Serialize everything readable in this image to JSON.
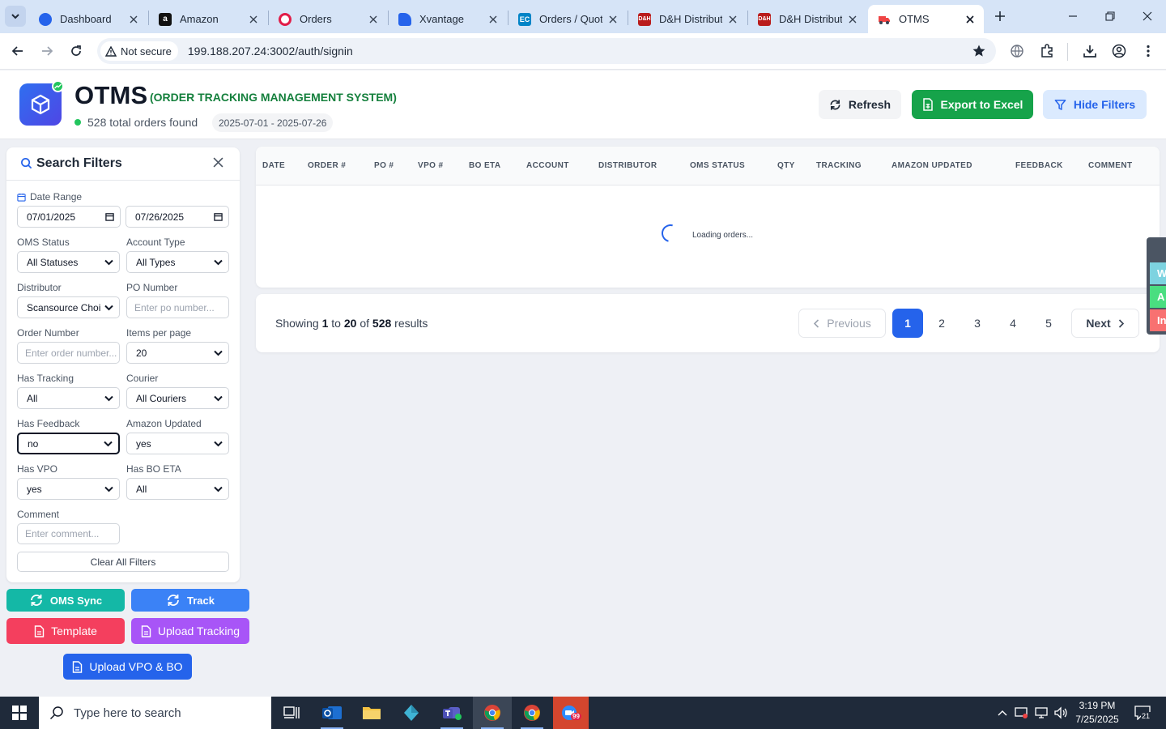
{
  "browser": {
    "tabs": [
      {
        "title": "Dashboard",
        "favicon": "globe-icon",
        "color": "#2563eb"
      },
      {
        "title": "Amazon",
        "favicon": "amazon-icon",
        "color": "#111111"
      },
      {
        "title": "Orders",
        "favicon": "orders-icon",
        "color": "#e11d48"
      },
      {
        "title": "Xvantage",
        "favicon": "xvantage-icon",
        "color": "#2563eb"
      },
      {
        "title": "Orders / Quot",
        "favicon": "ec-icon",
        "color": "#0284c7"
      },
      {
        "title": "D&H Distribut",
        "favicon": "dh-icon",
        "color": "#b91c1c"
      },
      {
        "title": "D&H Distribut",
        "favicon": "dh-icon",
        "color": "#b91c1c"
      },
      {
        "title": "OTMS",
        "favicon": "otms-icon",
        "color": "#ef4444",
        "active": true
      }
    ],
    "security_label": "Not secure",
    "url": "199.188.207.24:3002/auth/signin"
  },
  "header": {
    "title": "OTMS",
    "subtitle": "(ORDER TRACKING MANAGEMENT SYSTEM)",
    "orders_found": "528 total orders found",
    "date_range": "2025-07-01 - 2025-07-26",
    "refresh_label": "Refresh",
    "export_label": "Export to Excel",
    "hide_filters_label": "Hide Filters"
  },
  "filters": {
    "title": "Search Filters",
    "date_range_label": "Date Range",
    "date_from": "07/01/2025",
    "date_to": "07/26/2025",
    "oms_status": {
      "label": "OMS Status",
      "value": "All Statuses"
    },
    "account_type": {
      "label": "Account Type",
      "value": "All Types"
    },
    "distributor": {
      "label": "Distributor",
      "value": "Scansource Choi"
    },
    "po_number": {
      "label": "PO Number",
      "placeholder": "Enter po number..."
    },
    "order_number": {
      "label": "Order Number",
      "placeholder": "Enter order number..."
    },
    "items_per_page": {
      "label": "Items per page",
      "value": "20"
    },
    "has_tracking": {
      "label": "Has Tracking",
      "value": "All"
    },
    "courier": {
      "label": "Courier",
      "value": "All Couriers"
    },
    "has_feedback": {
      "label": "Has Feedback",
      "value": "no"
    },
    "amazon_updated": {
      "label": "Amazon Updated",
      "value": "yes"
    },
    "has_vpo": {
      "label": "Has VPO",
      "value": "yes"
    },
    "has_bo_eta": {
      "label": "Has BO ETA",
      "value": "All"
    },
    "comment": {
      "label": "Comment",
      "placeholder": "Enter comment..."
    },
    "clear_label": "Clear All Filters"
  },
  "actions": {
    "oms_sync": "OMS Sync",
    "track": "Track",
    "template": "Template",
    "upload_tracking": "Upload Tracking",
    "upload_vpo": "Upload VPO & BO"
  },
  "table": {
    "columns": [
      "DATE",
      "ORDER #",
      "PO #",
      "VPO #",
      "BO ETA",
      "ACCOUNT",
      "DISTRIBUTOR",
      "OMS STATUS",
      "QTY",
      "TRACKING",
      "AMAZON UPDATED",
      "FEEDBACK",
      "COMMENT"
    ],
    "loading_text": "Loading orders..."
  },
  "pagination": {
    "showing_prefix": "Showing",
    "from": "1",
    "to_word": "to",
    "to": "20",
    "of_word": "of",
    "total": "528",
    "results_word": "results",
    "previous": "Previous",
    "next": "Next",
    "pages": [
      "1",
      "2",
      "3",
      "4",
      "5"
    ],
    "current_page": "1"
  },
  "edge_widget": [
    {
      "label": "W",
      "color": "#7dd3e0"
    },
    {
      "label": "A",
      "color": "#4ade80"
    },
    {
      "label": "In",
      "color": "#f87171"
    }
  ],
  "taskbar": {
    "search_placeholder": "Type here to search",
    "time": "3:19 PM",
    "date": "7/25/2025",
    "notification_count": "21",
    "zoom_badge": "99"
  },
  "colors": {
    "primary": "#2563eb",
    "success": "#16a34a",
    "teal": "#14b8a6",
    "pink": "#f43f5e",
    "purple": "#a855f7"
  }
}
